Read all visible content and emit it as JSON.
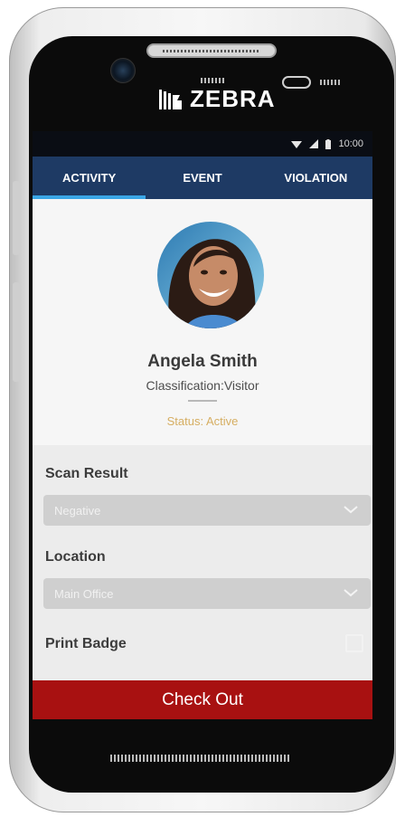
{
  "device": {
    "brand": "ZEBRA"
  },
  "status_bar": {
    "time": "10:00"
  },
  "tabs": [
    {
      "label": "ACTIVITY",
      "active": true
    },
    {
      "label": "EVENT",
      "active": false
    },
    {
      "label": "VIOLATION",
      "active": false
    }
  ],
  "profile": {
    "name": "Angela Smith",
    "classification": "Classification:Visitor",
    "status": "Status: Active"
  },
  "form": {
    "scan_result": {
      "label": "Scan Result",
      "value": "Negative"
    },
    "location": {
      "label": "Location",
      "value": "Main Office"
    },
    "print_badge": {
      "label": "Print Badge",
      "checked": false
    }
  },
  "actions": {
    "checkout_label": "Check Out"
  },
  "colors": {
    "tab_bar": "#1e3a64",
    "tab_indicator": "#3aa6e6",
    "status_active": "#d6ae62",
    "checkout": "#a81111"
  },
  "icons": [
    "zebra-logo-icon",
    "wifi-icon",
    "signal-icon",
    "battery-icon",
    "chevron-down-icon"
  ]
}
